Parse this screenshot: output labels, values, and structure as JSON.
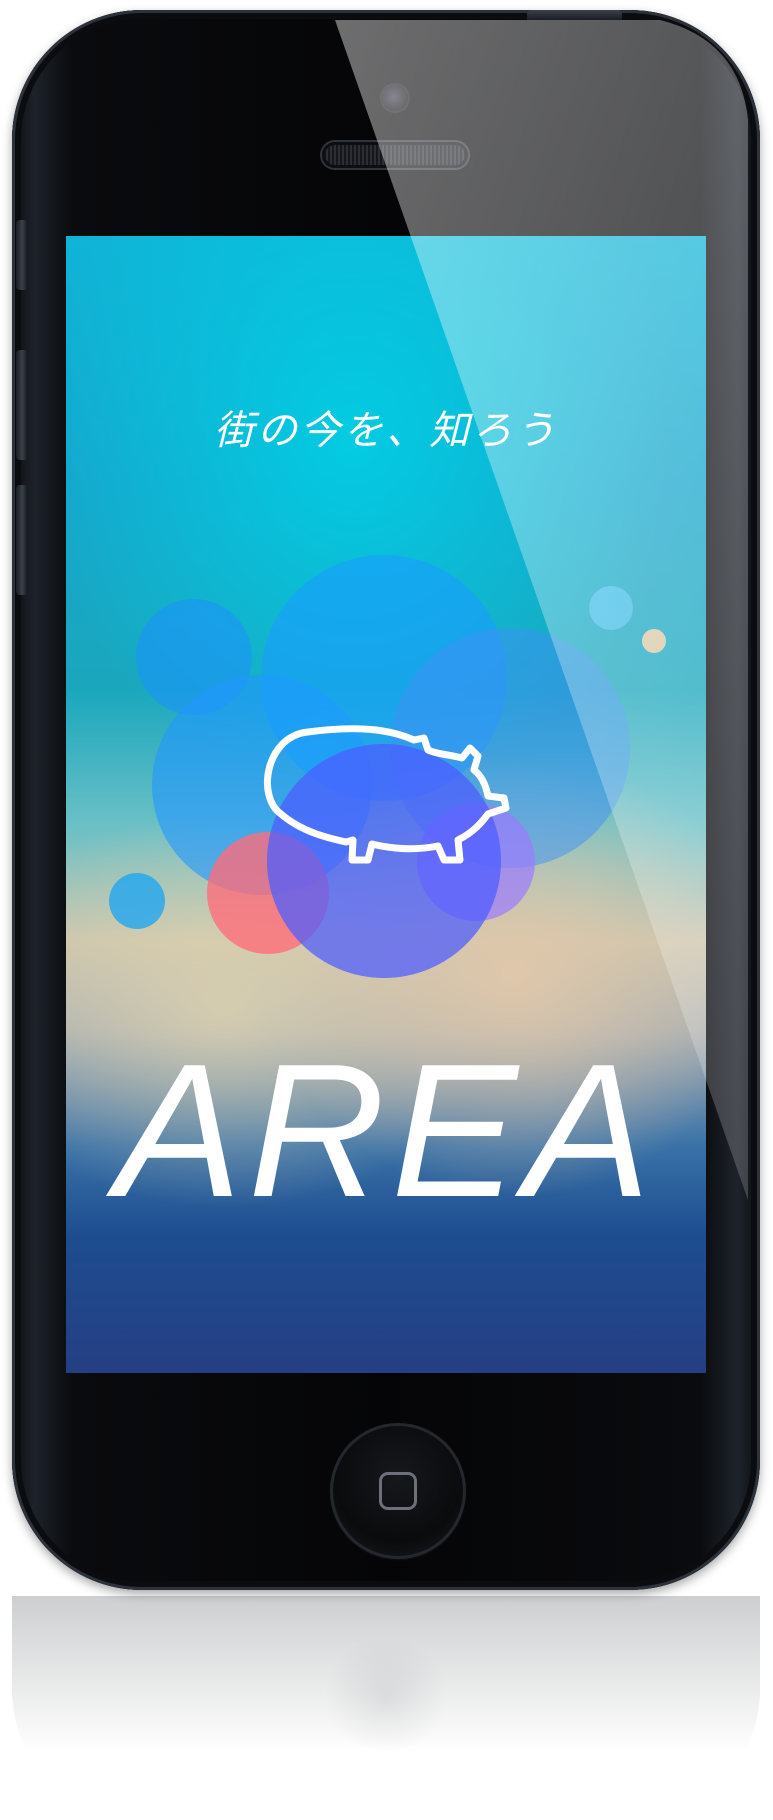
{
  "app": {
    "tagline": "街の今を、知ろう",
    "brand_name": "AREA"
  },
  "colors": {
    "phone_body": "#050507",
    "screen_top": "#10b4d6",
    "screen_bottom": "#253e84",
    "accent_blue": "#1e90ff",
    "accent_purple": "#6a4cff",
    "accent_coral": "#ff7a80",
    "accent_beige": "#e4c9a6",
    "text": "#ffffff"
  },
  "icons": {
    "logo": "pig-icon",
    "home": "home-button-icon"
  }
}
